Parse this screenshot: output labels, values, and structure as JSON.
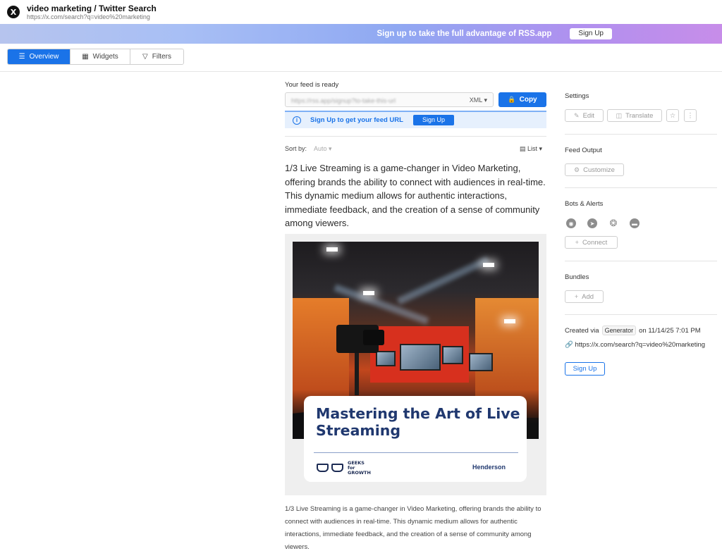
{
  "header": {
    "logo_glyph": "X",
    "title": "video marketing / Twitter Search",
    "url": "https://x.com/search?q=video%20marketing"
  },
  "banner": {
    "text": "Sign up to take the full advantage of RSS.app",
    "button": "Sign Up"
  },
  "tabs": [
    {
      "label": "Overview",
      "icon": "list-icon",
      "active": true
    },
    {
      "label": "Widgets",
      "icon": "grid-icon",
      "active": false
    },
    {
      "label": "Filters",
      "icon": "filter-icon",
      "active": false
    }
  ],
  "feed": {
    "ready_label": "Your feed is ready",
    "url_blurred": "https://rss.app/signup?to-take-this-url",
    "format": "XML",
    "copy_label": "Copy",
    "signup_notice": "Sign Up to get your feed URL",
    "signup_button": "Sign Up",
    "sort_label": "Sort by:",
    "sort_value": "Auto",
    "view_value": "List"
  },
  "post": {
    "text": "1/3 Live Streaming is a game-changer in Video Marketing, offering brands the ability to connect with audiences in real-time. This dynamic medium allows for authentic interactions, immediate feedback, and the creation of a sense of community among viewers.",
    "image": {
      "card_title": "Mastering the Art of Live Streaming",
      "logo_line1": "GEEKS",
      "logo_line2": "for",
      "logo_line3": "GROWTH",
      "author": "Henderson"
    },
    "description": "1/3 Live Streaming is a game-changer in Video Marketing, offering brands the ability to connect with audiences in real-time. This dynamic medium allows for authentic interactions, immediate feedback, and the creation of a sense of community among viewers."
  },
  "sidebar": {
    "settings_label": "Settings",
    "edit_label": "Edit",
    "translate_label": "Translate",
    "feed_output_label": "Feed Output",
    "customize_label": "Customize",
    "bots_label": "Bots & Alerts",
    "bot_icons": [
      "discord-icon",
      "telegram-icon",
      "slack-icon",
      "chat-icon"
    ],
    "connect_label": "Connect",
    "bundles_label": "Bundles",
    "add_label": "Add",
    "created_via": "Created via",
    "generator": "Generator",
    "created_on": "on 11/14/25 7:01 PM",
    "source_url": "https://x.com/search?q=video%20marketing",
    "signup_label": "Sign Up"
  },
  "colors": {
    "accent": "#1a73e8",
    "card_title": "#20386f"
  }
}
